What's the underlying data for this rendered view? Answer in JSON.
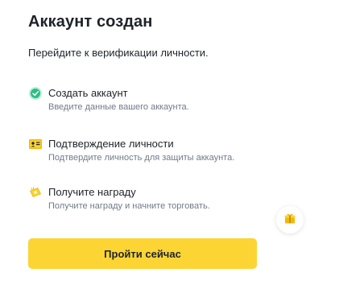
{
  "header": {
    "title": "Аккаунт создан",
    "subtitle": "Перейдите к верификации личности."
  },
  "steps": [
    {
      "label": "Создать аккаунт",
      "description": "Введите данные вашего аккаунта.",
      "icon": "check-circle-icon",
      "status": "completed"
    },
    {
      "label": "Подтверждение личности",
      "description": "Подтвердите личность для защиты аккаунта.",
      "icon": "id-card-icon",
      "status": "pending"
    },
    {
      "label": "Получите награду",
      "description": "Получите награду и начните торговать.",
      "icon": "reward-ticket-icon",
      "status": "pending"
    }
  ],
  "floating_button": {
    "icon": "gift-icon"
  },
  "cta": {
    "label": "Пройти сейчас"
  },
  "colors": {
    "accent": "#fcd535",
    "success": "#2ebd85",
    "text_primary": "#1e2329",
    "text_secondary": "#707a8a"
  }
}
